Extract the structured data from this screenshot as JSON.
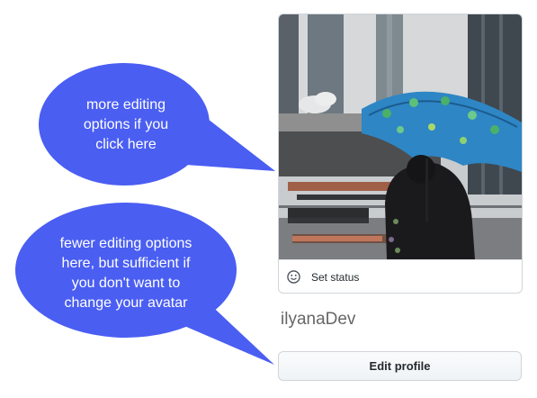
{
  "profile": {
    "set_status_label": "Set status",
    "username": "ilyanaDev",
    "edit_profile_label": "Edit profile"
  },
  "icons": {
    "status": "smiley-icon"
  },
  "callouts": [
    {
      "text": "more editing\noptions if you\nclick here"
    },
    {
      "text": "fewer editing options\nhere, but sufficient if\nyou don't want to\nchange your avatar"
    }
  ],
  "colors": {
    "callout_fill": "#4a5ef2",
    "button_border": "#d1d5da",
    "username": "#666666"
  }
}
